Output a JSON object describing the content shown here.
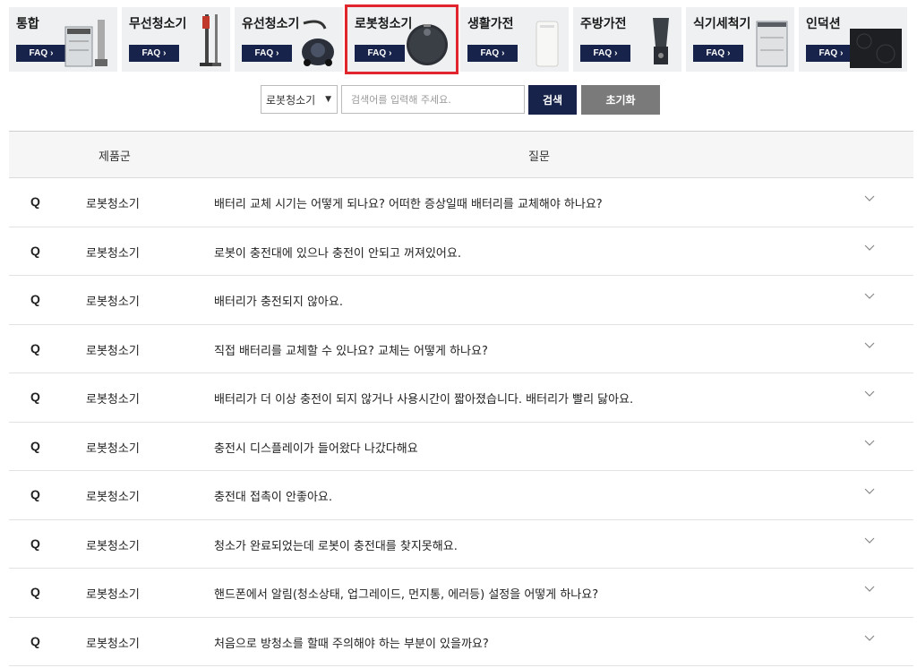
{
  "categories": [
    {
      "label": "통합",
      "faq": "FAQ",
      "icon": "dishwasher-bundle-icon"
    },
    {
      "label": "무선청소기",
      "faq": "FAQ",
      "icon": "stick-vacuum-icon"
    },
    {
      "label": "유선청소기",
      "faq": "FAQ",
      "icon": "canister-vacuum-icon"
    },
    {
      "label": "로봇청소기",
      "faq": "FAQ",
      "icon": "robot-vacuum-icon",
      "selected": true
    },
    {
      "label": "생활가전",
      "faq": "FAQ",
      "icon": "air-purifier-icon"
    },
    {
      "label": "주방가전",
      "faq": "FAQ",
      "icon": "blender-icon"
    },
    {
      "label": "식기세척기",
      "faq": "FAQ",
      "icon": "dishwasher-icon"
    },
    {
      "label": "인덕션",
      "faq": "FAQ",
      "icon": "induction-cooktop-icon"
    }
  ],
  "search": {
    "selected_category": "로봇청소기",
    "placeholder": "검색어를 입력해 주세요.",
    "search_label": "검색",
    "reset_label": "초기화"
  },
  "table": {
    "headers": {
      "category": "제품군",
      "question": "질문"
    },
    "rows": [
      {
        "q": "Q",
        "category": "로봇청소기",
        "question": "배터리 교체 시기는 어떻게 되나요? 어떠한 증상일때 배터리를 교체해야 하나요?"
      },
      {
        "q": "Q",
        "category": "로봇청소기",
        "question": "로봇이 충전대에 있으나 충전이 안되고 꺼져있어요."
      },
      {
        "q": "Q",
        "category": "로봇청소기",
        "question": "배터리가 충전되지 않아요."
      },
      {
        "q": "Q",
        "category": "로봇청소기",
        "question": "직접 배터리를 교체할 수 있나요? 교체는 어떻게 하나요?"
      },
      {
        "q": "Q",
        "category": "로봇청소기",
        "question": "배터리가 더 이상 충전이 되지 않거나 사용시간이 짧아졌습니다. 배터리가 빨리 닳아요."
      },
      {
        "q": "Q",
        "category": "로봇청소기",
        "question": "충전시 디스플레이가 들어왔다 나갔다해요"
      },
      {
        "q": "Q",
        "category": "로봇청소기",
        "question": "충전대 접촉이 안좋아요."
      },
      {
        "q": "Q",
        "category": "로봇청소기",
        "question": "청소가 완료되었는데 로봇이 충전대를 찾지못해요."
      },
      {
        "q": "Q",
        "category": "로봇청소기",
        "question": "핸드폰에서 알림(청소상태, 업그레이드, 먼지통, 에러등) 설정을 어떻게 하나요?"
      },
      {
        "q": "Q",
        "category": "로봇청소기",
        "question": "처음으로 방청소를 할때 주의해야 하는 부분이 있을까요?"
      }
    ]
  },
  "colors": {
    "accent": "#17234a",
    "selected_outline": "#e0262c",
    "reset_button": "#7a7a7a"
  }
}
